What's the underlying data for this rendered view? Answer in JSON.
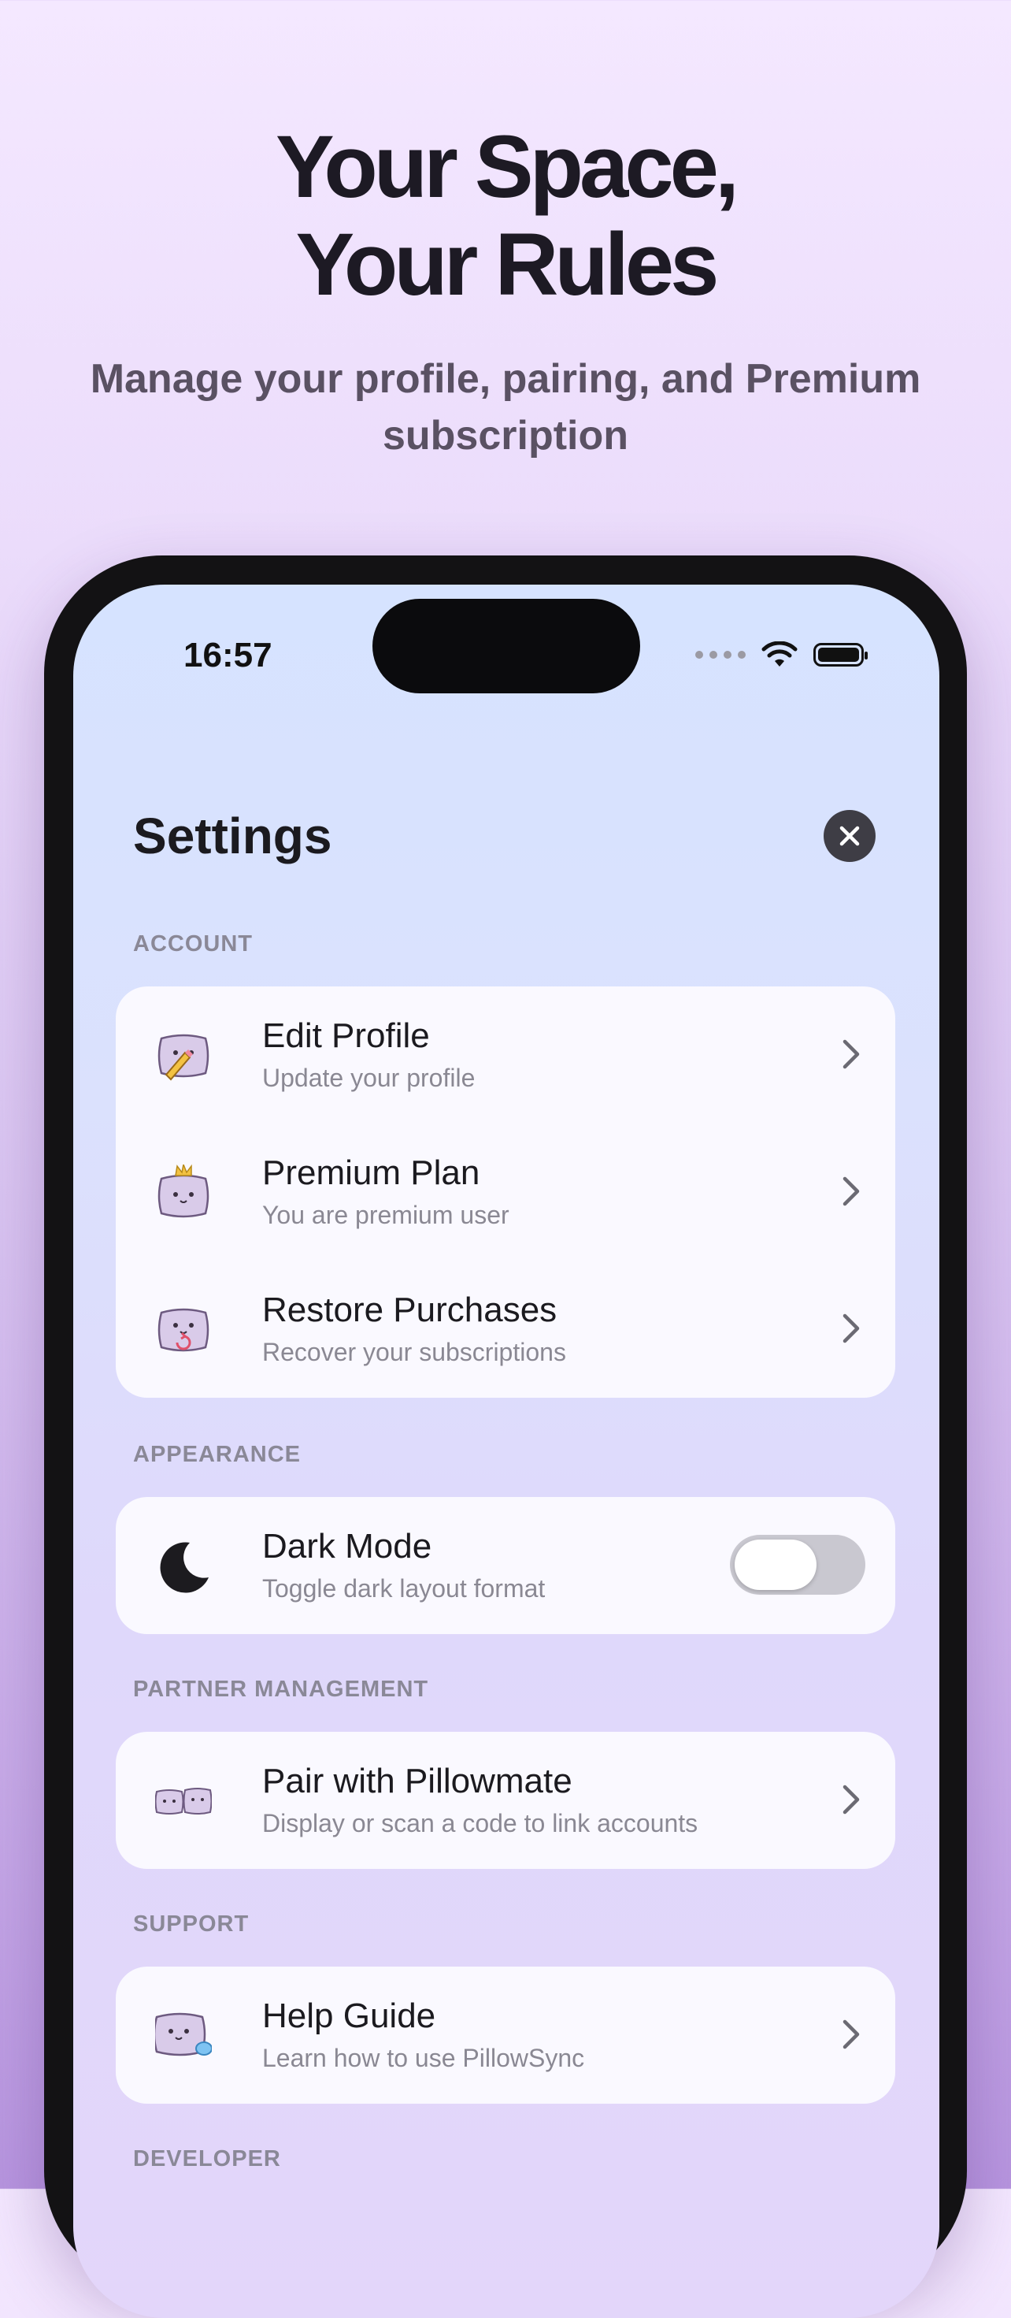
{
  "promo": {
    "title_line1": "Your Space,",
    "title_line2": "Your Rules",
    "subtitle": "Manage your profile, pairing, and Premium subscription"
  },
  "status_bar": {
    "time": "16:57",
    "icons": [
      "signal-dots-icon",
      "wifi-icon",
      "battery-icon"
    ]
  },
  "header": {
    "title": "Settings",
    "close_icon": "close-icon"
  },
  "sections": {
    "account": {
      "label": "ACCOUNT",
      "items": [
        {
          "label": "Edit Profile",
          "sub": "Update your profile",
          "icon": "pillow-pencil-icon"
        },
        {
          "label": "Premium Plan",
          "sub": "You are premium user",
          "icon": "pillow-crown-icon"
        },
        {
          "label": "Restore Purchases",
          "sub": "Recover your subscriptions",
          "icon": "pillow-restore-icon"
        }
      ]
    },
    "appearance": {
      "label": "APPEARANCE",
      "items": [
        {
          "label": "Dark Mode",
          "sub": "Toggle dark layout format",
          "icon": "moon-icon",
          "toggle_on": false
        }
      ]
    },
    "partner": {
      "label": "PARTNER MANAGEMENT",
      "items": [
        {
          "label": "Pair with Pillowmate",
          "sub": "Display or scan a code to link accounts",
          "icon": "pillow-pair-icon"
        }
      ]
    },
    "support": {
      "label": "SUPPORT",
      "items": [
        {
          "label": "Help Guide",
          "sub": "Learn how to use PillowSync",
          "icon": "pillow-help-icon"
        }
      ]
    },
    "developer": {
      "label": "DEVELOPER"
    }
  },
  "colors": {
    "accent_pillow": "#d9cbe9",
    "background_top": "#f4e8ff",
    "card": "#faf9ff",
    "text_primary": "#1b1a1f",
    "text_secondary": "#8a8893"
  }
}
